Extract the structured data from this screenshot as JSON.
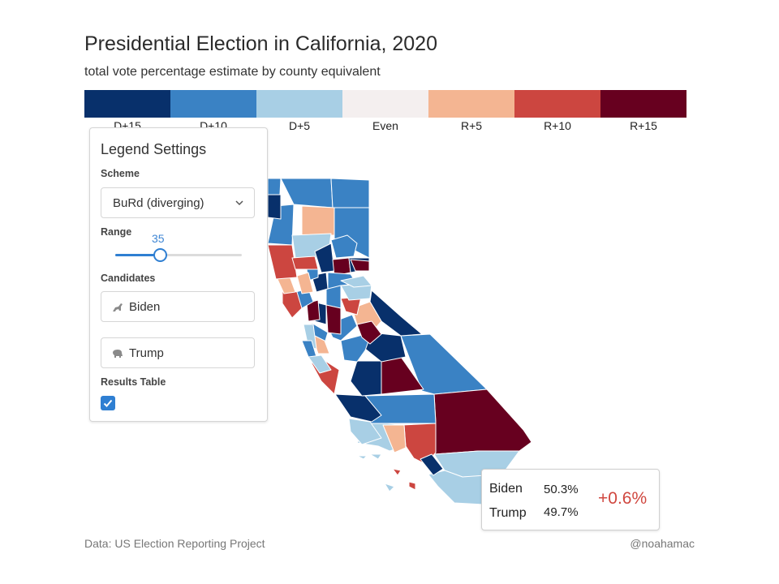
{
  "header": {
    "title": "Presidential Election in California, 2020",
    "subtitle": "total vote percentage estimate by county equivalent"
  },
  "legend": {
    "bins": [
      {
        "label": "D+15",
        "color": "#08306b"
      },
      {
        "label": "D+10",
        "color": "#3a82c4"
      },
      {
        "label": "D+5",
        "color": "#a8cfe5"
      },
      {
        "label": "Even",
        "color": "#f4efef"
      },
      {
        "label": "R+5",
        "color": "#f4b592"
      },
      {
        "label": "R+10",
        "color": "#cc4640"
      },
      {
        "label": "R+15",
        "color": "#67001f"
      }
    ]
  },
  "settings": {
    "title": "Legend Settings",
    "scheme_label": "Scheme",
    "scheme_value": "BuRd (diverging)",
    "range_label": "Range",
    "range_value": "35",
    "range_fraction": 0.33,
    "candidates_label": "Candidates",
    "candidate_1": "Biden",
    "candidate_1_icon": "donkey-icon",
    "candidate_2": "Trump",
    "candidate_2_icon": "elephant-icon",
    "results_table_label": "Results Table",
    "results_table_checked": true
  },
  "tooltip": {
    "row1_name": "Biden",
    "row1_pct": "50.3%",
    "row2_name": "Trump",
    "row2_pct": "49.7%",
    "margin": "+0.6%"
  },
  "footer": {
    "source": "Data: US Election Reporting Project",
    "credit": "@noahamac"
  }
}
